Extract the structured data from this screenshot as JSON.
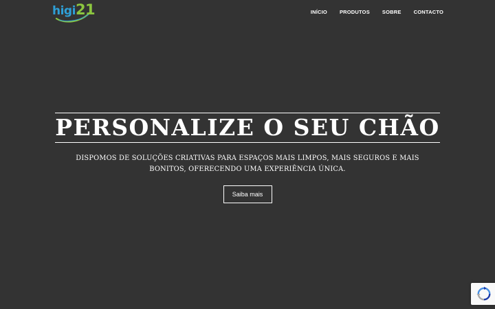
{
  "header": {
    "logo": {
      "text_part1": "higi",
      "text_part2": "21",
      "colors": {
        "primary": "#2e9fd6",
        "secondary": "#8cc63f"
      }
    },
    "nav": [
      {
        "label": "INÍCIO"
      },
      {
        "label": "PRODUTOS"
      },
      {
        "label": "SOBRE"
      },
      {
        "label": "CONTACTO"
      }
    ]
  },
  "hero": {
    "title": "PERSONALIZE O SEU CHÃO",
    "subtitle": "DISPOMOS DE SOLUÇÕES CRIATIVAS PARA ESPAÇOS MAIS LIMPOS, MAIS SEGUROS E MAIS BONITOS, OFERECENDO UMA EXPERIÊNCIA ÚNICA.",
    "button_label": "Saiba mais"
  },
  "recaptcha": {
    "icon": "recaptcha-icon"
  },
  "colors": {
    "background": "#333333",
    "text": "#ffffff"
  }
}
